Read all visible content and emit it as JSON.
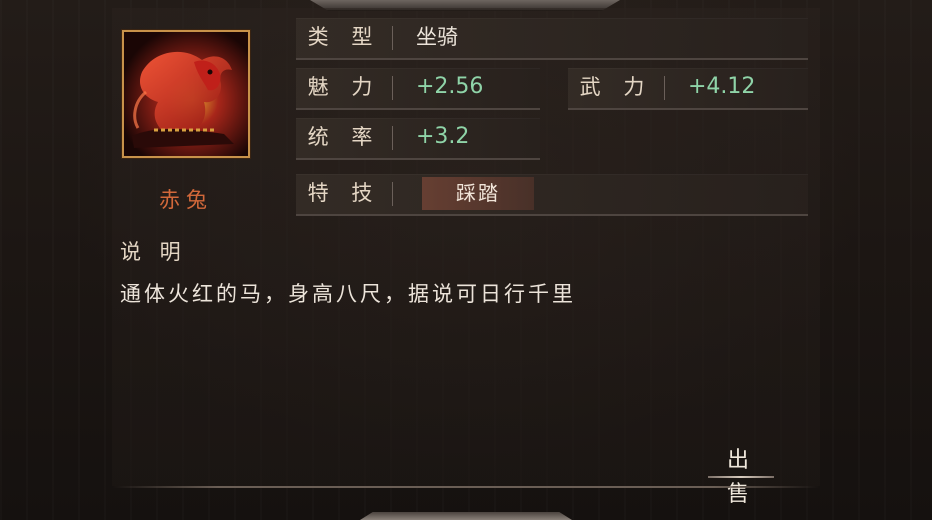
{
  "item": {
    "name": "赤兔",
    "icon": "red-horse-portrait"
  },
  "attributes": {
    "type": {
      "label": "类 型",
      "value": "坐骑"
    },
    "charm": {
      "label": "魅 力",
      "value": "+2.56"
    },
    "force": {
      "label": "武 力",
      "value": "+4.12"
    },
    "command": {
      "label": "统 率",
      "value": "+3.2"
    },
    "skill": {
      "label": "特 技",
      "value": "踩踏"
    }
  },
  "description": {
    "title": "说 明",
    "text": "通体火红的马，身高八尺，据说可日行千里"
  },
  "actions": {
    "sell_label": "出 售"
  },
  "colors": {
    "stat_value": "#8fd4a8",
    "item_name": "#d2683a",
    "portrait_border": "#c8924a"
  }
}
